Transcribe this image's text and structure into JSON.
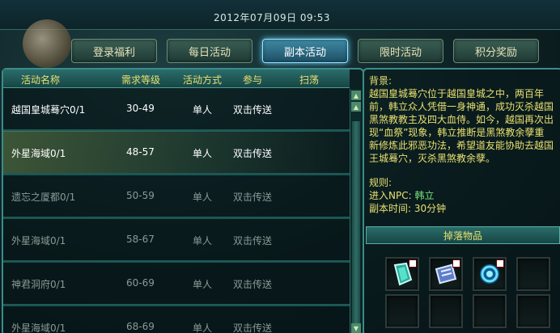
{
  "header": {
    "datetime": "2012年07月09日  09:53"
  },
  "tabs": [
    {
      "label": "登录福利",
      "active": false
    },
    {
      "label": "每日活动",
      "active": false
    },
    {
      "label": "副本活动",
      "active": true
    },
    {
      "label": "限时活动",
      "active": false
    },
    {
      "label": "积分奖励",
      "active": false
    }
  ],
  "table": {
    "columns": [
      "活动名称",
      "需求等级",
      "活动方式",
      "参与",
      "扫荡"
    ],
    "rows": [
      {
        "name": "越国皇城蓦穴0/1",
        "level": "30-49",
        "mode": "单人",
        "join": "双击传送",
        "sweep": "",
        "enabled": true,
        "highlight": false
      },
      {
        "name": "外星海域0/1",
        "level": "48-57",
        "mode": "单人",
        "join": "双击传送",
        "sweep": "",
        "enabled": true,
        "highlight": true
      },
      {
        "name": "遗忘之厦都0/1",
        "level": "50-59",
        "mode": "单人",
        "join": "双击传送",
        "sweep": "",
        "enabled": false,
        "highlight": false
      },
      {
        "name": "外星海域0/1",
        "level": "58-67",
        "mode": "单人",
        "join": "双击传送",
        "sweep": "",
        "enabled": false,
        "highlight": false
      },
      {
        "name": "神君洞府0/1",
        "level": "60-69",
        "mode": "单人",
        "join": "双击传送",
        "sweep": "",
        "enabled": false,
        "highlight": false
      },
      {
        "name": "外星海域0/1",
        "level": "68-69",
        "mode": "单人",
        "join": "双击传送",
        "sweep": "",
        "enabled": false,
        "highlight": false
      }
    ]
  },
  "detail": {
    "background_label": "背景:",
    "background_text": "越国皇城蓦穴位于越国皇城之中，两百年前，韩立众人凭借一身神通，成功灭杀越国黑煞教教主及四大血侍。如今，越国再次出现“血祭”现象，韩立推断是黑煞教余孽重新修炼此邪恶功法，希望道友能协助去越国王城蓦穴，灭杀黑煞教余孽。",
    "rules_label": "规则:",
    "npc_label": "进入NPC:",
    "npc_value": "韩立",
    "time_label": "副本时间:",
    "time_value": "30分钟",
    "drops_title": "掉落物品",
    "drops": [
      {
        "icon": "crystal-icon",
        "badge": true
      },
      {
        "icon": "scroll-icon",
        "badge": true
      },
      {
        "icon": "swirl-orb-icon",
        "badge": true
      },
      {
        "icon": "",
        "badge": false
      },
      {
        "icon": "",
        "badge": false
      },
      {
        "icon": "",
        "badge": false
      },
      {
        "icon": "",
        "badge": false
      },
      {
        "icon": "",
        "badge": false
      }
    ]
  }
}
